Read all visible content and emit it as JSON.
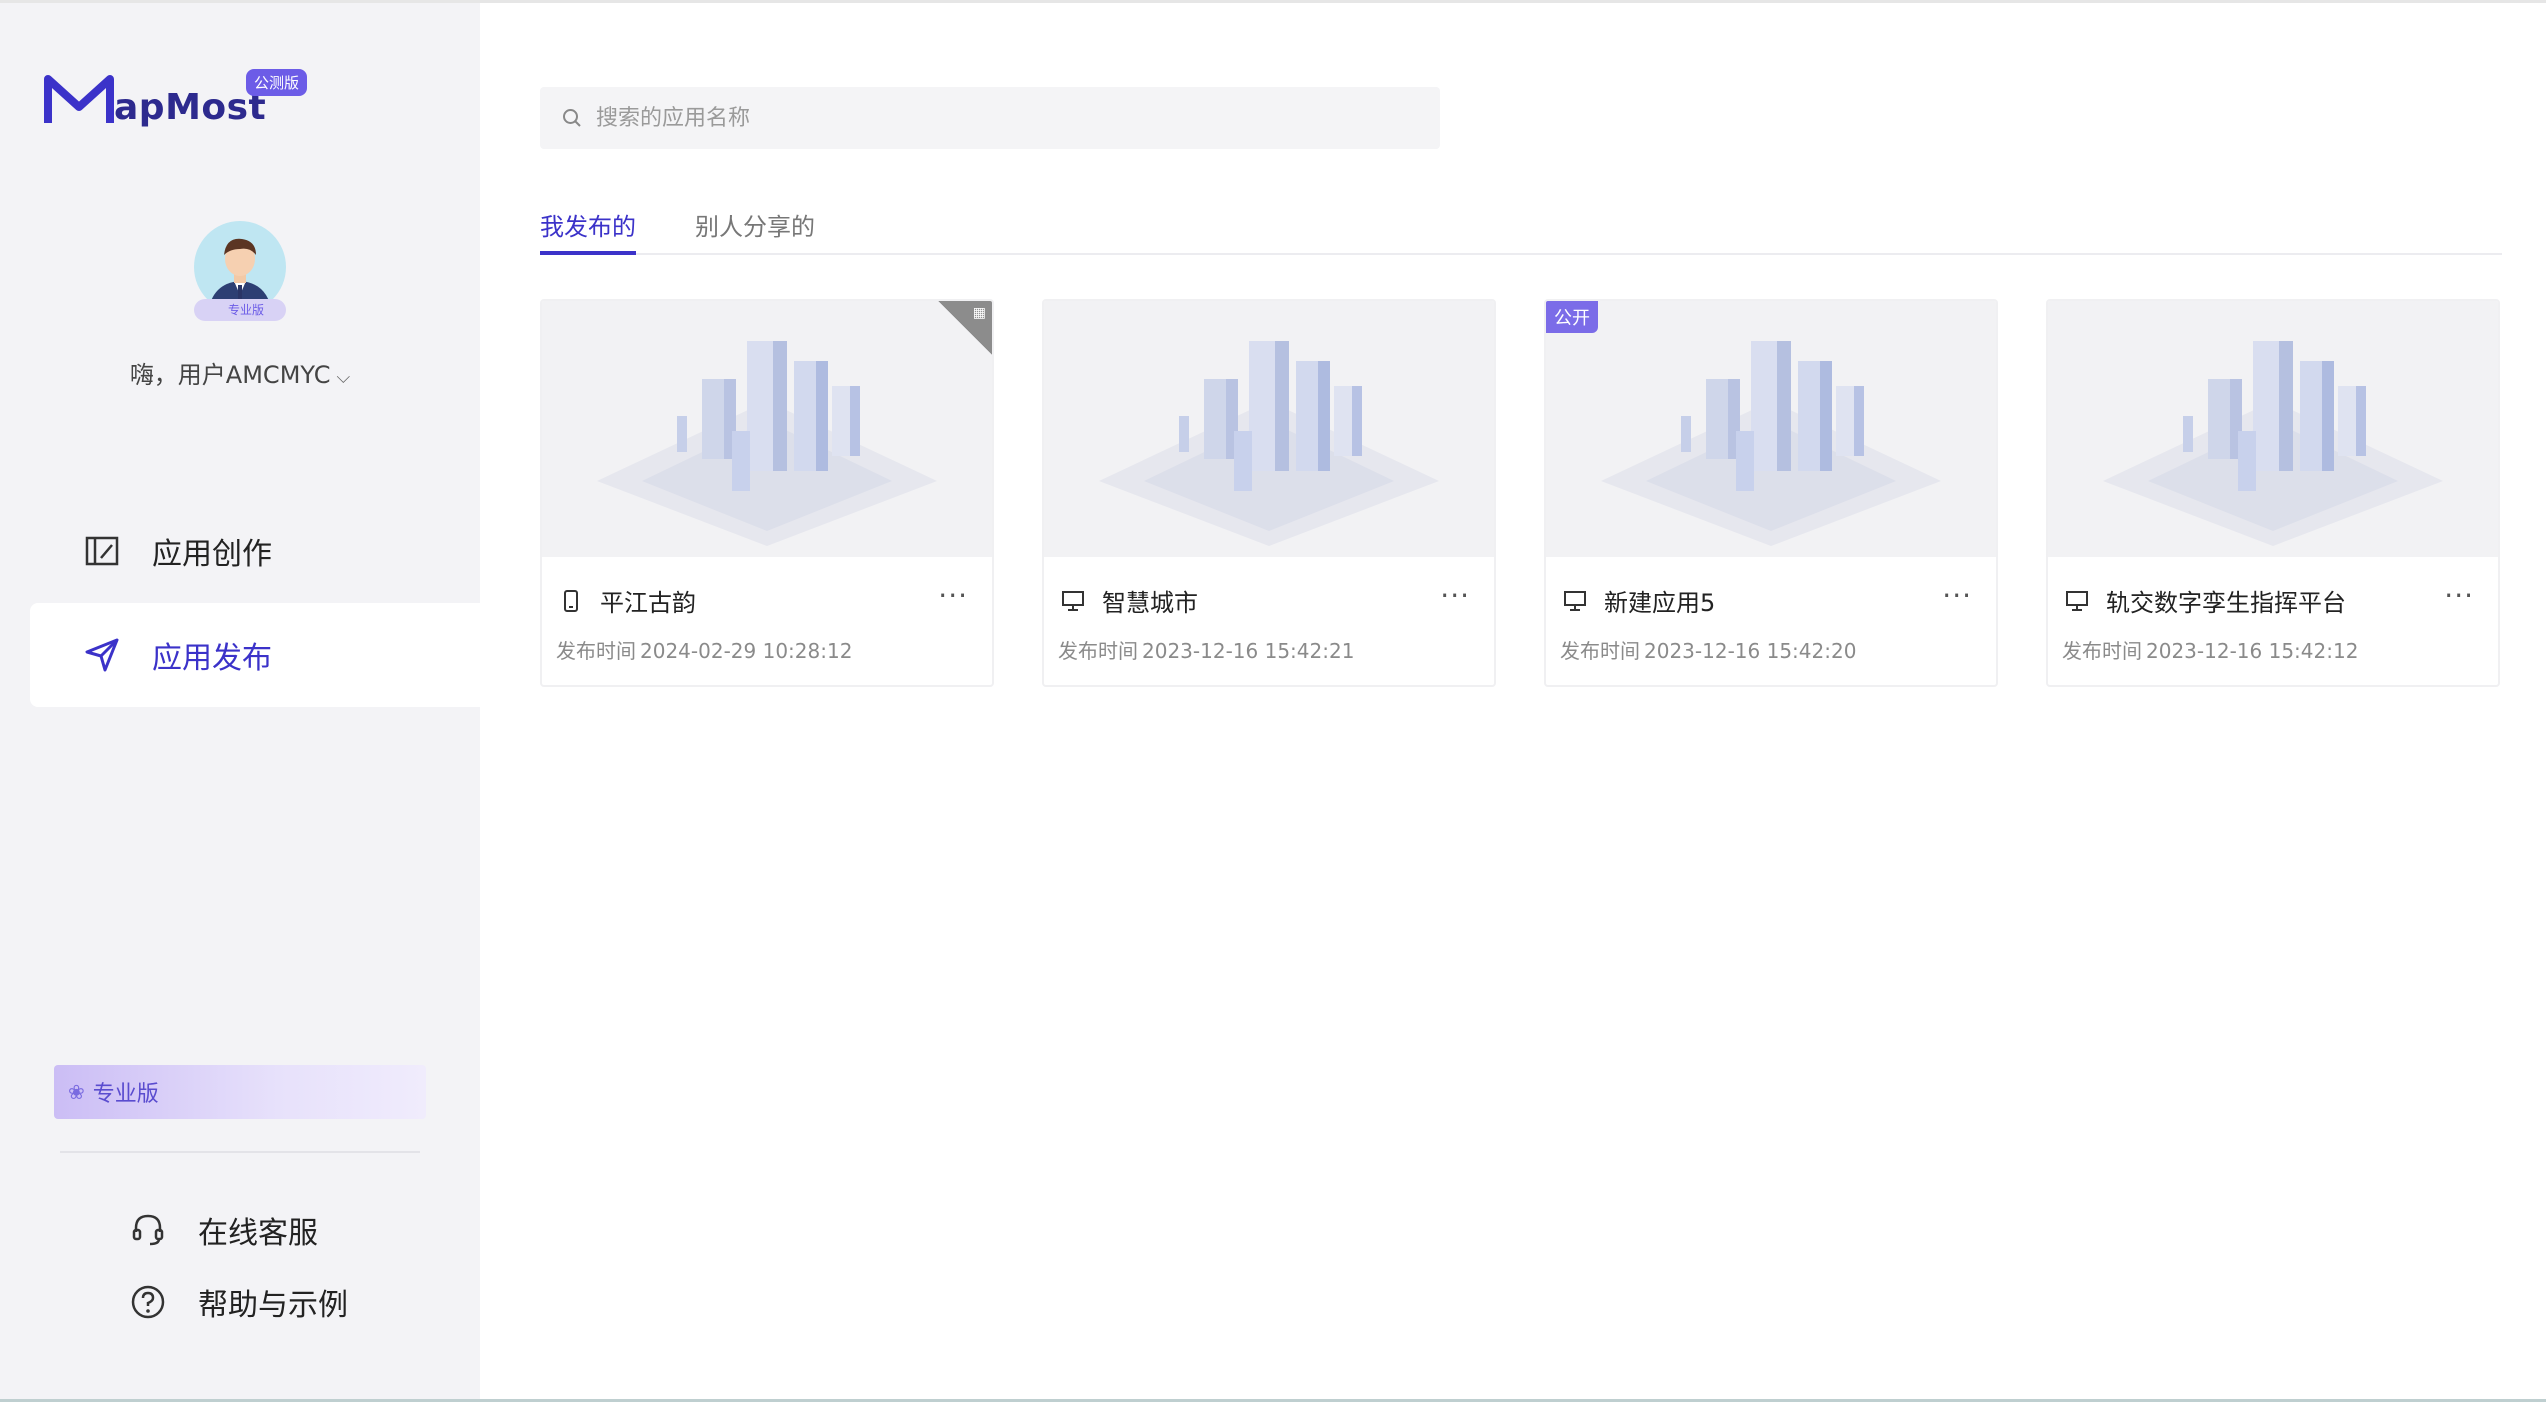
{
  "brand": {
    "logo_text": "apMost",
    "beta_badge": "公测版"
  },
  "user": {
    "avatar_badge": "专业版",
    "greeting": "嗨，用户AMCMYC"
  },
  "nav": {
    "items": [
      {
        "label": "应用创作",
        "icon": "app-create-icon",
        "active": false
      },
      {
        "label": "应用发布",
        "icon": "send-icon",
        "active": true
      }
    ]
  },
  "plan_banner": {
    "label": "专业版"
  },
  "footer_links": {
    "support": "在线客服",
    "help": "帮助与示例"
  },
  "search": {
    "placeholder": "搜索的应用名称",
    "value": ""
  },
  "tabs": [
    {
      "label": "我发布的",
      "active": true
    },
    {
      "label": "别人分享的",
      "active": false
    }
  ],
  "date_prefix": "发布时间",
  "cards": [
    {
      "title": "平江古韵",
      "device": "mobile-icon",
      "date": "2024-02-29 10:28:12",
      "qr_corner": true,
      "public_tag": ""
    },
    {
      "title": "智慧城市",
      "device": "desktop-icon",
      "date": "2023-12-16 15:42:21",
      "qr_corner": false,
      "public_tag": ""
    },
    {
      "title": "新建应用5",
      "device": "desktop-icon",
      "date": "2023-12-16 15:42:20",
      "qr_corner": false,
      "public_tag": "公开"
    },
    {
      "title": "轨交数字孪生指挥平台",
      "device": "desktop-icon",
      "date": "2023-12-16 15:42:12",
      "qr_corner": false,
      "public_tag": ""
    }
  ],
  "colors": {
    "accent": "#3b32c9",
    "tag": "#7b6ce8",
    "sidebar_bg": "#f3f3f6"
  }
}
